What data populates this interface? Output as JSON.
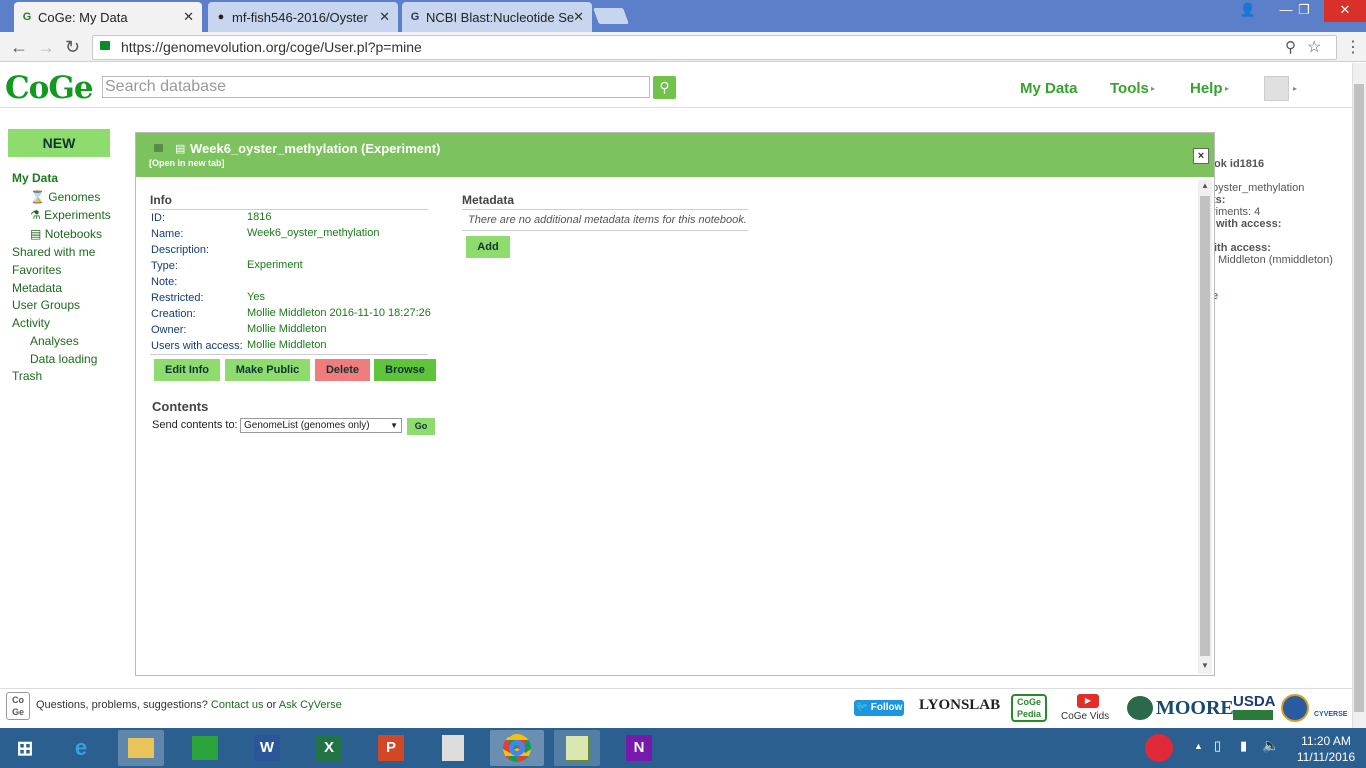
{
  "browser": {
    "tabs": [
      {
        "title": "CoGe: My Data",
        "active": true,
        "favicon": "coge-favicon"
      },
      {
        "title": "mf-fish546-2016/Oyster",
        "active": false,
        "favicon": "github-favicon"
      },
      {
        "title": "NCBI Blast:Nucleotide Se",
        "active": false,
        "favicon": "ncbi-favicon"
      }
    ],
    "url": "https://genomevolution.org/coge/User.pl?p=mine"
  },
  "site": {
    "logo": "CoGe",
    "search_placeholder": "Search database",
    "nav": {
      "mydata": "My Data",
      "tools": "Tools",
      "help": "Help"
    },
    "new_button": "NEW",
    "sidebar": {
      "mydata": "My Data",
      "genomes": "Genomes",
      "experiments": "Experiments",
      "notebooks": "Notebooks",
      "shared": "Shared with me",
      "favorites": "Favorites",
      "metadata": "Metadata",
      "usergroups": "User Groups",
      "activity": "Activity",
      "analyses": "Analyses",
      "dataloading": "Data loading",
      "trash": "Trash"
    },
    "background_panel": {
      "line1": "ok id1816",
      "line2": "oyster_methylation",
      "line3": "ts:",
      "line4": "riments: 4",
      "line5": "with access:",
      "line6": "ith access:",
      "line7": "Middleton (mmiddleton)",
      "line8": "e"
    }
  },
  "dialog": {
    "title": "Week6_oyster_methylation (Experiment)",
    "open_link": "[Open in new tab]",
    "close": "×",
    "info": {
      "heading": "Info",
      "fields": {
        "id_label": "ID:",
        "id": "1816",
        "name_label": "Name:",
        "name": "Week6_oyster_methylation",
        "desc_label": "Description:",
        "type_label": "Type:",
        "type": "Experiment",
        "note_label": "Note:",
        "restricted_label": "Restricted:",
        "restricted": "Yes",
        "creation_label": "Creation:",
        "creation": "Mollie Middleton 2016-11-10 18:27:26",
        "owner_label": "Owner:",
        "owner": "Mollie Middleton",
        "users_label": "Users with access:",
        "users": "Mollie Middleton"
      },
      "buttons": {
        "edit": "Edit Info",
        "public": "Make Public",
        "delete": "Delete",
        "browse": "Browse"
      }
    },
    "metadata": {
      "heading": "Metadata",
      "note": "There are no additional metadata items for this notebook.",
      "add": "Add"
    },
    "contents": {
      "heading": "Contents",
      "send_label": "Send contents to:",
      "selected": "GenomeList (genomes only)",
      "go": "Go"
    }
  },
  "footer": {
    "text": "Questions, problems, suggestions?",
    "contact": "Contact us",
    "or": "or",
    "ask": "Ask CyVerse",
    "follow": "Follow",
    "lyonslab": "LYONSLAB",
    "cogepedia": "CoGe Pedia",
    "cogevids": "CoGe Vids",
    "moore": "MOORE",
    "usda": "USDA",
    "poweredby": "CYVERSE"
  },
  "taskbar": {
    "time": "11:20 AM",
    "date": "11/11/2016"
  }
}
